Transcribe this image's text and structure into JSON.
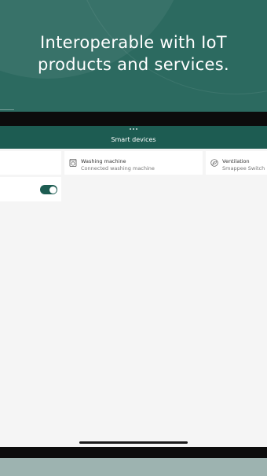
{
  "promo": {
    "headline_line1": "Interoperable with IoT",
    "headline_line2": "products and services."
  },
  "header": {
    "title": "Smart devices"
  },
  "devices": [
    {
      "title": "Washing machine",
      "subtitle": "Connected washing machine",
      "icon": "washing-machine-icon"
    },
    {
      "title": "Ventilation",
      "subtitle": "Smappee Switch",
      "icon": "leaf-icon"
    }
  ],
  "toggle": {
    "state": "on"
  },
  "colors": {
    "brand": "#1d5c52",
    "promo_bg": "#2c6a60",
    "content_bg": "#f5f5f5",
    "card_bg": "#ffffff"
  }
}
